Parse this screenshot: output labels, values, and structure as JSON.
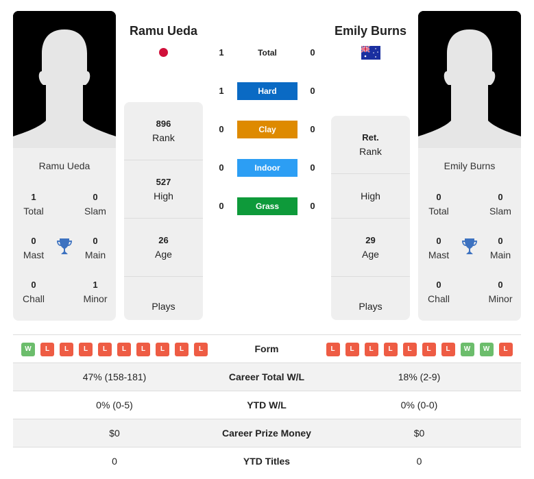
{
  "player1": {
    "name": "Ramu Ueda",
    "flag": "japan-flag-icon",
    "card_name": "Ramu Ueda",
    "titles": {
      "total": {
        "value": "1",
        "label": "Total"
      },
      "slam": {
        "value": "0",
        "label": "Slam"
      },
      "mast": {
        "value": "0",
        "label": "Mast"
      },
      "main": {
        "value": "0",
        "label": "Main"
      },
      "chall": {
        "value": "0",
        "label": "Chall"
      },
      "minor": {
        "value": "1",
        "label": "Minor"
      }
    },
    "rank": {
      "value": "896",
      "label": "Rank"
    },
    "high": {
      "value": "527",
      "label": "High"
    },
    "age": {
      "value": "26",
      "label": "Age"
    },
    "plays": {
      "value": "",
      "label": "Plays"
    },
    "form": [
      "W",
      "L",
      "L",
      "L",
      "L",
      "L",
      "L",
      "L",
      "L",
      "L"
    ]
  },
  "player2": {
    "name": "Emily Burns",
    "flag": "australia-flag-icon",
    "card_name": "Emily Burns",
    "titles": {
      "total": {
        "value": "0",
        "label": "Total"
      },
      "slam": {
        "value": "0",
        "label": "Slam"
      },
      "mast": {
        "value": "0",
        "label": "Mast"
      },
      "main": {
        "value": "0",
        "label": "Main"
      },
      "chall": {
        "value": "0",
        "label": "Chall"
      },
      "minor": {
        "value": "0",
        "label": "Minor"
      }
    },
    "rank": {
      "value": "Ret.",
      "label": "Rank"
    },
    "high": {
      "value": "",
      "label": "High"
    },
    "age": {
      "value": "29",
      "label": "Age"
    },
    "plays": {
      "value": "",
      "label": "Plays"
    },
    "form": [
      "L",
      "L",
      "L",
      "L",
      "L",
      "L",
      "L",
      "W",
      "W",
      "L"
    ]
  },
  "h2h": [
    {
      "label": "Total",
      "p1": "1",
      "p2": "0",
      "color": ""
    },
    {
      "label": "Hard",
      "p1": "1",
      "p2": "0",
      "color": "#0a6ac4"
    },
    {
      "label": "Clay",
      "p1": "0",
      "p2": "0",
      "color": "#de8a00"
    },
    {
      "label": "Indoor",
      "p1": "0",
      "p2": "0",
      "color": "#2c9ef4"
    },
    {
      "label": "Grass",
      "p1": "0",
      "p2": "0",
      "color": "#0e9a3a"
    }
  ],
  "table": {
    "form_label": "Form",
    "rows": [
      {
        "label": "Career Total W/L",
        "p1": "47% (158-181)",
        "p2": "18% (2-9)"
      },
      {
        "label": "YTD W/L",
        "p1": "0% (0-5)",
        "p2": "0% (0-0)"
      },
      {
        "label": "Career Prize Money",
        "p1": "$0",
        "p2": "$0"
      },
      {
        "label": "YTD Titles",
        "p1": "0",
        "p2": "0"
      }
    ]
  }
}
